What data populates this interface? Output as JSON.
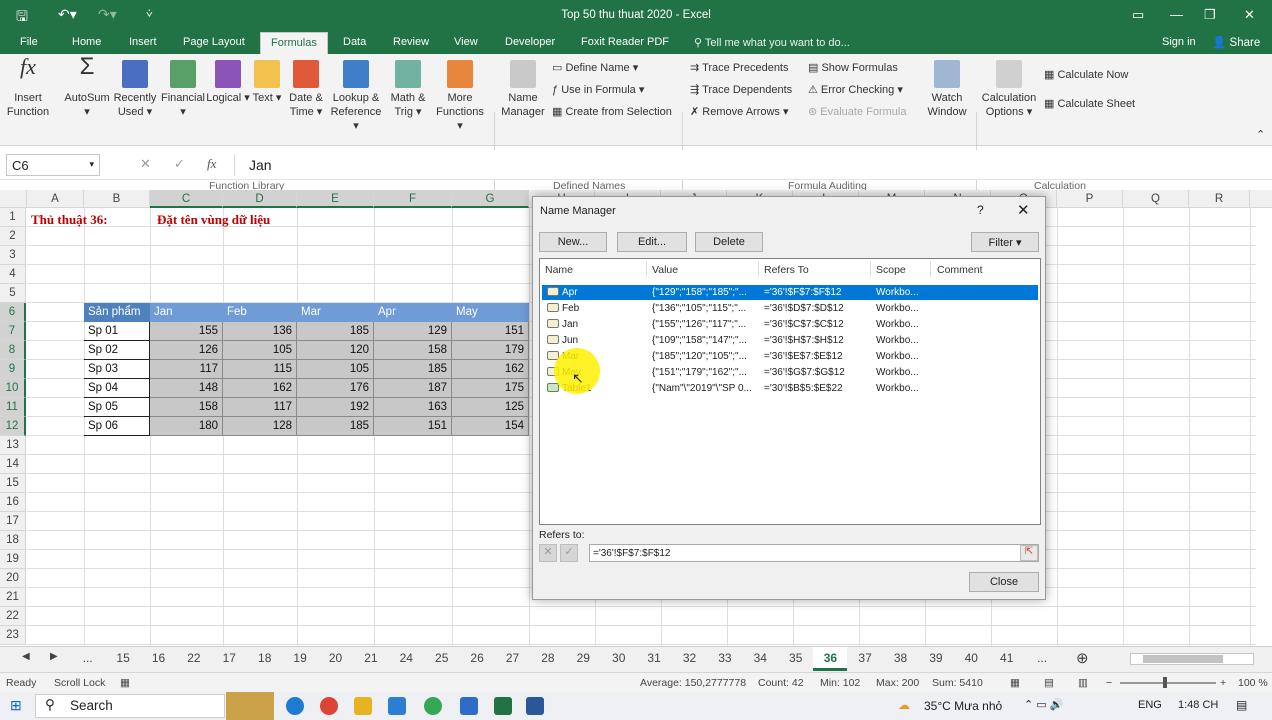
{
  "window": {
    "title": "Top 50 thu thuat 2020 - Excel"
  },
  "tabs": [
    "File",
    "Home",
    "Insert",
    "Page Layout",
    "Formulas",
    "Data",
    "Review",
    "View",
    "Developer",
    "Foxit Reader PDF"
  ],
  "tell_me": "Tell me what you want to do...",
  "sign_in": "Sign in",
  "share": "Share",
  "ribbon": {
    "insert_function": "Insert Function",
    "autosum": "AutoSum",
    "recently_used": "Recently Used",
    "financial": "Financial",
    "logical": "Logical",
    "text": "Text",
    "date_time": "Date & Time",
    "lookup_reference": "Lookup & Reference",
    "math_trig": "Math & Trig",
    "more_functions": "More Functions",
    "function_library": "Function Library",
    "name_manager": "Name Manager",
    "define_name": "Define Name",
    "use_in_formula": "Use in Formula",
    "create_from_selection": "Create from Selection",
    "defined_names": "Defined Names",
    "trace_precedents": "Trace Precedents",
    "trace_dependents": "Trace Dependents",
    "remove_arrows": "Remove Arrows",
    "show_formulas": "Show Formulas",
    "error_checking": "Error Checking",
    "evaluate_formula": "Evaluate Formula",
    "watch_window": "Watch Window",
    "formula_auditing": "Formula Auditing",
    "calculation_options": "Calculation Options",
    "calculate_now": "Calculate Now",
    "calculate_sheet": "Calculate Sheet",
    "calculation": "Calculation"
  },
  "formula_bar": {
    "name_box": "C6",
    "value": "Jan"
  },
  "columns": [
    "A",
    "B",
    "C",
    "D",
    "E",
    "F",
    "G",
    "H",
    "I",
    "J",
    "K",
    "L",
    "M",
    "N",
    "O",
    "P",
    "Q",
    "R",
    "S"
  ],
  "rows": [
    "1",
    "2",
    "3",
    "4",
    "5",
    "6",
    "7",
    "8",
    "9",
    "10",
    "11",
    "12",
    "13",
    "14",
    "15",
    "16",
    "17",
    "18",
    "19",
    "20",
    "21",
    "22",
    "23"
  ],
  "sheet": {
    "a1": "Thủ thuật 36:",
    "c1": "Đặt tên vùng dữ liệu",
    "headers": [
      "Sản phẩm",
      "Jan",
      "Feb",
      "Mar",
      "Apr",
      "May"
    ],
    "data": [
      [
        "Sp 01",
        "155",
        "136",
        "185",
        "129",
        "151"
      ],
      [
        "Sp 02",
        "126",
        "105",
        "120",
        "158",
        "179"
      ],
      [
        "Sp 03",
        "117",
        "115",
        "105",
        "185",
        "162"
      ],
      [
        "Sp 04",
        "148",
        "162",
        "176",
        "187",
        "175"
      ],
      [
        "Sp 05",
        "158",
        "117",
        "192",
        "163",
        "125"
      ],
      [
        "Sp 06",
        "180",
        "128",
        "185",
        "151",
        "154"
      ]
    ]
  },
  "dialog": {
    "title": "Name Manager",
    "help": "?",
    "close_x": "✕",
    "new": "New...",
    "edit": "Edit...",
    "delete": "Delete",
    "filter": "Filter",
    "cols": [
      "Name",
      "Value",
      "Refers To",
      "Scope",
      "Comment"
    ],
    "items": [
      {
        "name": "Apr",
        "value": "{\"129\";\"158\";\"185\";\"...",
        "refers": "='36'!$F$7:$F$12",
        "scope": "Workbo..."
      },
      {
        "name": "Feb",
        "value": "{\"136\";\"105\";\"115\";\"...",
        "refers": "='36'!$D$7:$D$12",
        "scope": "Workbo..."
      },
      {
        "name": "Jan",
        "value": "{\"155\";\"126\";\"117\";\"...",
        "refers": "='36'!$C$7:$C$12",
        "scope": "Workbo..."
      },
      {
        "name": "Jun",
        "value": "{\"109\";\"158\";\"147\";\"...",
        "refers": "='36'!$H$7:$H$12",
        "scope": "Workbo..."
      },
      {
        "name": "Mar",
        "value": "{\"185\";\"120\";\"105\";\"...",
        "refers": "='36'!$E$7:$E$12",
        "scope": "Workbo..."
      },
      {
        "name": "May",
        "value": "{\"151\";\"179\";\"162\";\"...",
        "refers": "='36'!$G$7:$G$12",
        "scope": "Workbo..."
      },
      {
        "name": "Table1",
        "value": "{\"Nam\"\\\"2019\"\\\"SP 0...",
        "refers": "='30'!$B$5:$E$22",
        "scope": "Workbo..."
      }
    ],
    "refers_to_label": "Refers to:",
    "refers_to_value": "='36'!$F$7:$F$12",
    "close": "Close"
  },
  "sheet_tabs": [
    "...",
    "15",
    "16",
    "22",
    "17",
    "18",
    "19",
    "20",
    "21",
    "24",
    "25",
    "26",
    "27",
    "28",
    "29",
    "30",
    "31",
    "32",
    "33",
    "34",
    "35",
    "36",
    "37",
    "38",
    "39",
    "40",
    "41",
    "..."
  ],
  "active_sheet": "36",
  "status": {
    "ready": "Ready",
    "scroll_lock": "Scroll Lock",
    "average": "Average: 150,2777778",
    "count": "Count: 42",
    "min": "Min: 102",
    "max": "Max: 200",
    "sum": "Sum: 5410",
    "zoom": "100 %"
  },
  "taskbar": {
    "search": "Search",
    "weather": "35°C  Mưa nhỏ",
    "lang": "ENG",
    "time": "1:48 CH"
  }
}
